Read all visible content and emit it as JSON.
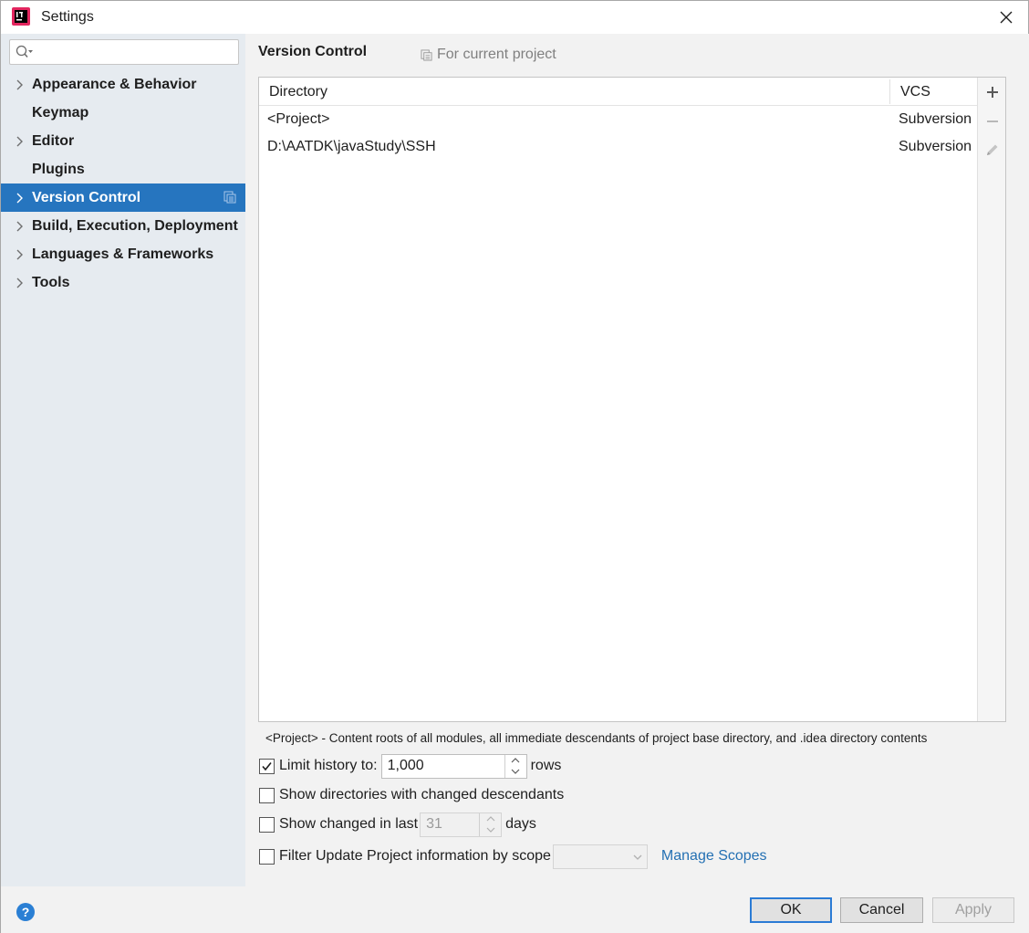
{
  "window": {
    "title": "Settings"
  },
  "sidebar": {
    "search": {
      "value": "",
      "placeholder": ""
    },
    "items": [
      {
        "label": "Appearance & Behavior",
        "expandable": true,
        "selected": false
      },
      {
        "label": "Keymap",
        "expandable": false,
        "selected": false
      },
      {
        "label": "Editor",
        "expandable": true,
        "selected": false
      },
      {
        "label": "Plugins",
        "expandable": false,
        "selected": false
      },
      {
        "label": "Version Control",
        "expandable": true,
        "selected": true
      },
      {
        "label": "Build, Execution, Deployment",
        "expandable": true,
        "selected": false
      },
      {
        "label": "Languages & Frameworks",
        "expandable": true,
        "selected": false
      },
      {
        "label": "Tools",
        "expandable": true,
        "selected": false
      }
    ]
  },
  "main": {
    "title": "Version Control",
    "scope_label": "For current project",
    "table": {
      "columns": [
        "Directory",
        "VCS"
      ],
      "rows": [
        {
          "directory": "<Project>",
          "vcs": "Subversion"
        },
        {
          "directory": "D:\\AATDK\\javaStudy\\SSH",
          "vcs": "Subversion"
        }
      ]
    },
    "note": "<Project> - Content roots of all modules, all immediate descendants of project base directory, and .idea directory contents",
    "options": {
      "limit_history": {
        "checked": true,
        "label": "Limit history to:",
        "value": "1,000",
        "unit": "rows"
      },
      "show_dirs": {
        "checked": false,
        "label": "Show directories with changed descendants"
      },
      "show_changed": {
        "checked": false,
        "label": "Show changed in last",
        "value": "31",
        "unit": "days"
      },
      "filter_update": {
        "checked": false,
        "label": "Filter Update Project information by scope",
        "scope_value": "",
        "link": "Manage Scopes"
      }
    }
  },
  "footer": {
    "help": "?",
    "ok": "OK",
    "cancel": "Cancel",
    "apply": "Apply"
  },
  "colors": {
    "selection": "#2675bf",
    "sidebar_bg": "#e6ebf0",
    "link": "#2470b3",
    "help": "#2a7fd4"
  }
}
